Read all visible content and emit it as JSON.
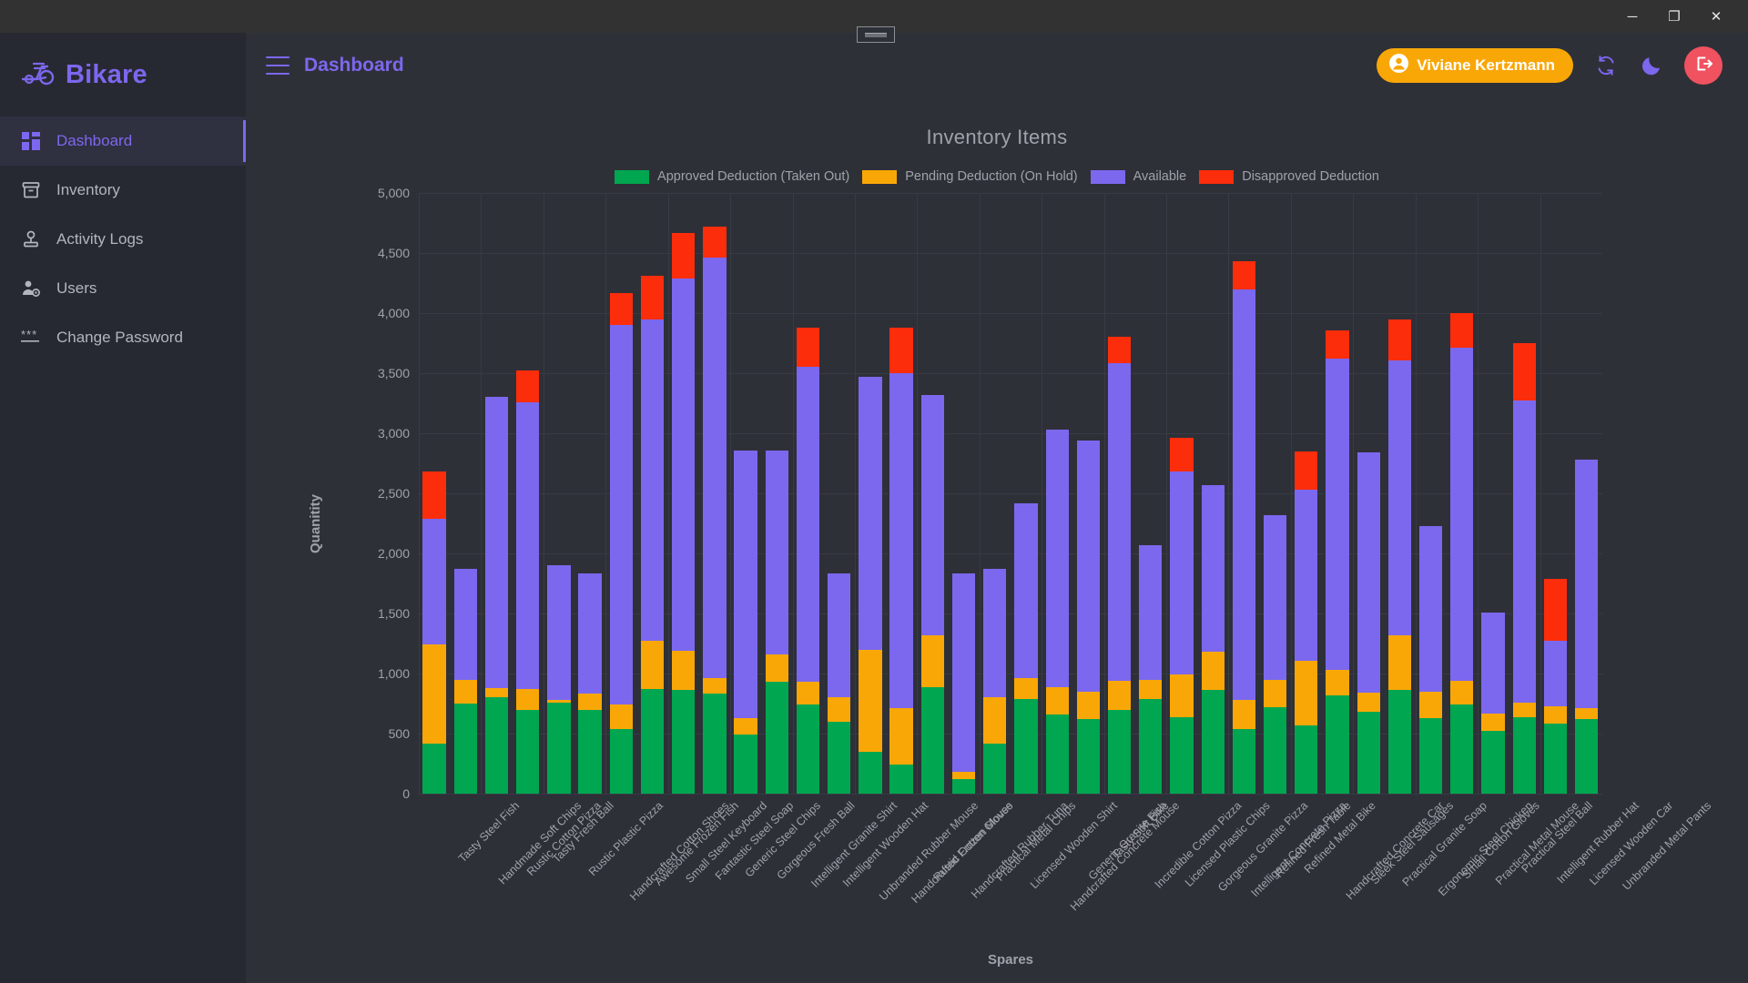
{
  "window": {
    "minimize_label": "─",
    "maximize_label": "❐",
    "close_label": "✕"
  },
  "brand": {
    "name": "Bikare",
    "logo_icon": "scooter-icon",
    "accent": "#7b68ee"
  },
  "sidebar": {
    "items": [
      {
        "label": "Dashboard",
        "icon": "dashboard-grid-icon",
        "active": true
      },
      {
        "label": "Inventory",
        "icon": "archive-box-icon",
        "active": false
      },
      {
        "label": "Activity Logs",
        "icon": "stamp-icon",
        "active": false
      },
      {
        "label": "Users",
        "icon": "user-gear-icon",
        "active": false
      },
      {
        "label": "Change Password",
        "icon": "asterisks-icon",
        "active": false
      }
    ]
  },
  "topbar": {
    "menu_icon": "hamburger-icon",
    "title": "Dashboard",
    "user_name": "Viviane Kertzmann",
    "user_icon": "user-circle-icon",
    "refresh_icon": "refresh-icon",
    "theme_icon": "moon-icon",
    "logout_icon": "logout-icon",
    "user_chip_color": "#f9a707",
    "logout_color": "#f0525f"
  },
  "chart_data": {
    "type": "bar",
    "stacked": true,
    "title": "Inventory Items",
    "xlabel": "Spares",
    "ylabel": "Quanitity",
    "ylim": [
      0,
      5000
    ],
    "yticks": [
      0,
      500,
      1000,
      1500,
      2000,
      2500,
      3000,
      3500,
      4000,
      4500,
      5000
    ],
    "ytick_labels": [
      "0",
      "500",
      "1,000",
      "1,500",
      "2,000",
      "2,500",
      "3,000",
      "3,500",
      "4,000",
      "4,500",
      "5,000"
    ],
    "grid": true,
    "legend_position": "top",
    "series": [
      {
        "name": "Approved Deduction (Taken Out)",
        "color": "#00a650"
      },
      {
        "name": "Pending Deduction (On Hold)",
        "color": "#f9a707"
      },
      {
        "name": "Available",
        "color": "#7b68ee"
      },
      {
        "name": "Disapproved Deduction",
        "color": "#fc2d0b"
      }
    ],
    "categories": [
      "Tasty Steel Fish",
      "Handmade Soft Chips",
      "Rustic Cotton Pizza",
      "Tasty Fresh Ball",
      "Rustic Plastic Pizza",
      "Handcrafted Cotton Shoes",
      "Awesome Frozen Fish",
      "Small Steel Keyboard",
      "Fantastic Steel Soap",
      "Generic Steel Chips",
      "Gorgeous Fresh Ball",
      "Intelligent Granite Shirt",
      "Intelligent Wooden Hat",
      "Unbranded Rubber Mouse",
      "Handcrafted Frozen Mouse",
      "Rustic Cotton Gloves",
      "Handcrafted Rubber Tuna",
      "Practical Metal Chips",
      "Licensed Wooden Shirt",
      "Handcrafted Concrete Mouse",
      "Generic Granite Fish",
      "Tasty Soft Bike",
      "Incredible Cotton Pizza",
      "Licensed Plastic Chips",
      "Gorgeous Granite Pizza",
      "Intelligent Concrete Pizza",
      "Refined Fresh Table",
      "Refined Metal Bike",
      "Handcrafted Concrete Car",
      "Sleek Steel Sausages",
      "Practical Granite Soap",
      "Ergonomic Steel Chicken",
      "Small Cotton Gloves",
      "Practical Metal Mouse",
      "Practical Steel Ball",
      "Intelligent Rubber Hat",
      "Licensed Wooden Car",
      "Unbranded Metal Pants"
    ],
    "bars": [
      {
        "approved": 420,
        "pending": 820,
        "available": 1050,
        "disapproved": 390
      },
      {
        "approved": 750,
        "pending": 200,
        "available": 920,
        "disapproved": 0
      },
      {
        "approved": 800,
        "pending": 80,
        "available": 2420,
        "disapproved": 0
      },
      {
        "approved": 700,
        "pending": 170,
        "available": 2390,
        "disapproved": 260
      },
      {
        "approved": 760,
        "pending": 20,
        "available": 1120,
        "disapproved": 0
      },
      {
        "approved": 700,
        "pending": 130,
        "available": 1000,
        "disapproved": 0
      },
      {
        "approved": 540,
        "pending": 200,
        "available": 3160,
        "disapproved": 270
      },
      {
        "approved": 870,
        "pending": 400,
        "available": 2680,
        "disapproved": 360
      },
      {
        "approved": 860,
        "pending": 330,
        "available": 3100,
        "disapproved": 380
      },
      {
        "approved": 830,
        "pending": 130,
        "available": 3500,
        "disapproved": 260
      },
      {
        "approved": 490,
        "pending": 140,
        "available": 2230,
        "disapproved": 0
      },
      {
        "approved": 930,
        "pending": 230,
        "available": 1700,
        "disapproved": 0
      },
      {
        "approved": 740,
        "pending": 190,
        "available": 2620,
        "disapproved": 330
      },
      {
        "approved": 600,
        "pending": 200,
        "available": 1030,
        "disapproved": 0
      },
      {
        "approved": 350,
        "pending": 850,
        "available": 2270,
        "disapproved": 0
      },
      {
        "approved": 240,
        "pending": 470,
        "available": 2790,
        "disapproved": 380
      },
      {
        "approved": 890,
        "pending": 430,
        "available": 2000,
        "disapproved": 0
      },
      {
        "approved": 120,
        "pending": 60,
        "available": 1650,
        "disapproved": 0
      },
      {
        "approved": 420,
        "pending": 380,
        "available": 1070,
        "disapproved": 0
      },
      {
        "approved": 790,
        "pending": 170,
        "available": 1460,
        "disapproved": 0
      },
      {
        "approved": 660,
        "pending": 230,
        "available": 2140,
        "disapproved": 0
      },
      {
        "approved": 620,
        "pending": 230,
        "available": 2090,
        "disapproved": 0
      },
      {
        "approved": 700,
        "pending": 240,
        "available": 2640,
        "disapproved": 220
      },
      {
        "approved": 790,
        "pending": 160,
        "available": 1120,
        "disapproved": 0
      },
      {
        "approved": 640,
        "pending": 350,
        "available": 1690,
        "disapproved": 280
      },
      {
        "approved": 860,
        "pending": 320,
        "available": 1390,
        "disapproved": 0
      },
      {
        "approved": 540,
        "pending": 240,
        "available": 3420,
        "disapproved": 230
      },
      {
        "approved": 720,
        "pending": 230,
        "available": 1370,
        "disapproved": 0
      },
      {
        "approved": 570,
        "pending": 540,
        "available": 1420,
        "disapproved": 320
      },
      {
        "approved": 820,
        "pending": 210,
        "available": 2590,
        "disapproved": 240
      },
      {
        "approved": 680,
        "pending": 160,
        "available": 2000,
        "disapproved": 0
      },
      {
        "approved": 860,
        "pending": 460,
        "available": 2290,
        "disapproved": 340
      },
      {
        "approved": 630,
        "pending": 220,
        "available": 1380,
        "disapproved": 0
      },
      {
        "approved": 740,
        "pending": 200,
        "available": 2770,
        "disapproved": 290
      },
      {
        "approved": 520,
        "pending": 150,
        "available": 840,
        "disapproved": 0
      },
      {
        "approved": 640,
        "pending": 120,
        "available": 2510,
        "disapproved": 480
      },
      {
        "approved": 580,
        "pending": 150,
        "available": 540,
        "disapproved": 520
      },
      {
        "approved": 620,
        "pending": 90,
        "available": 2070,
        "disapproved": 0
      }
    ]
  }
}
